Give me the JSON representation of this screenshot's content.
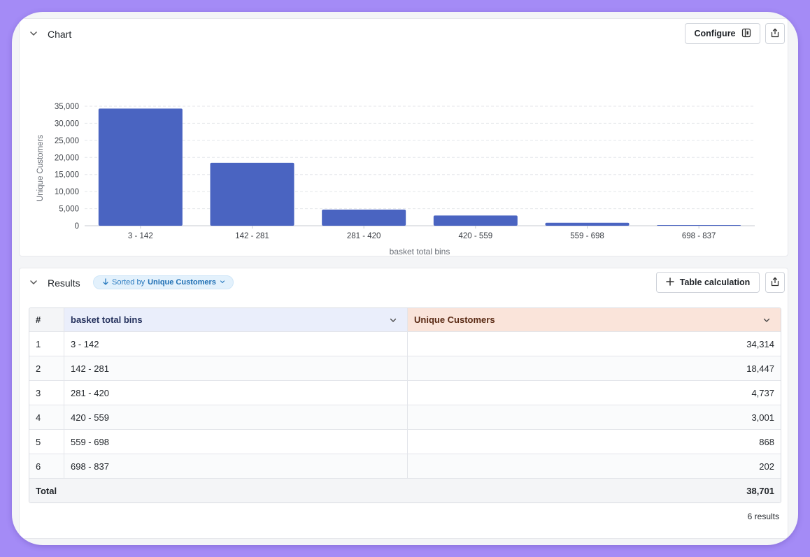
{
  "chart_section": {
    "title": "Chart",
    "configure_label": "Configure"
  },
  "chart_data": {
    "type": "bar",
    "categories": [
      "3 - 142",
      "142 - 281",
      "281 - 420",
      "420 - 559",
      "559 - 698",
      "698 - 837"
    ],
    "values": [
      34314,
      18447,
      4737,
      3001,
      868,
      202
    ],
    "xlabel": "basket total bins",
    "ylabel": "Unique Customers",
    "yticks": [
      "0",
      "5,000",
      "10,000",
      "15,000",
      "20,000",
      "25,000",
      "30,000",
      "35,000"
    ],
    "ylim": [
      0,
      35000
    ],
    "grid": true,
    "bar_color": "#4a64c1"
  },
  "results_section": {
    "title": "Results",
    "sort_prefix": "Sorted by",
    "sort_field": "Unique Customers",
    "table_calc_label": "Table calculation",
    "columns": [
      "#",
      "basket total bins",
      "Unique Customers"
    ],
    "rows": [
      {
        "n": "1",
        "bin": "3 - 142",
        "value": "34,314"
      },
      {
        "n": "2",
        "bin": "142 - 281",
        "value": "18,447"
      },
      {
        "n": "3",
        "bin": "281 - 420",
        "value": "4,737"
      },
      {
        "n": "4",
        "bin": "420 - 559",
        "value": "3,001"
      },
      {
        "n": "5",
        "bin": "559 - 698",
        "value": "868"
      },
      {
        "n": "6",
        "bin": "698 - 837",
        "value": "202"
      }
    ],
    "total_label": "Total",
    "total_value": "38,701",
    "results_count": "6 results"
  }
}
